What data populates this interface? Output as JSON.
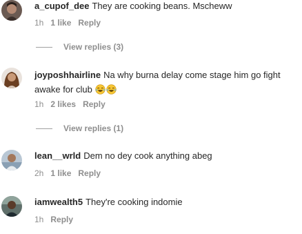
{
  "comments": [
    {
      "username": "a_cupof_dee",
      "text": "They are cooking beans. Mscheww",
      "time": "1h",
      "likes": "1 like",
      "reply": "Reply",
      "view_replies": "View replies (3)"
    },
    {
      "username": "joyposhhairline",
      "text": "Na why burna delay come stage him go fight awake for club",
      "emoji": "😂😂",
      "emoji_icon": "face-with-tears-of-joy",
      "time": "1h",
      "likes": "2 likes",
      "reply": "Reply",
      "view_replies": "View replies (1)"
    },
    {
      "username": "lean__wrld",
      "text": "Dem no dey cook anything abeg",
      "time": "2h",
      "likes": "1 like",
      "reply": "Reply"
    },
    {
      "username": "iamwealth5",
      "text": "They're cooking indomie",
      "time": "1h",
      "reply": "Reply"
    }
  ]
}
